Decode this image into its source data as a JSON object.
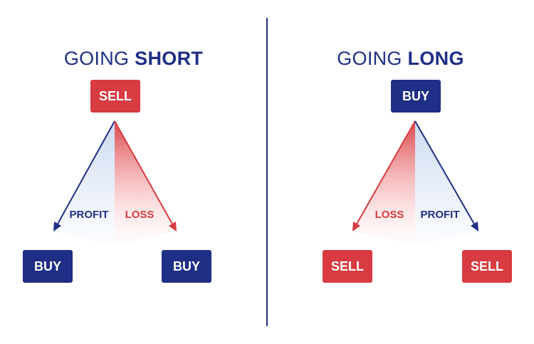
{
  "short": {
    "title_light": "GOING ",
    "title_bold": "SHORT",
    "top_box": "SELL",
    "left_box": "BUY",
    "right_box": "BUY",
    "left_label": "PROFIT",
    "right_label": "LOSS"
  },
  "long": {
    "title_light": "GOING ",
    "title_bold": "LONG",
    "top_box": "BUY",
    "left_box": "SELL",
    "right_box": "SELL",
    "left_label": "LOSS",
    "right_label": "PROFIT"
  },
  "colors": {
    "navy": "#1f2f86",
    "red": "#d83b41"
  }
}
